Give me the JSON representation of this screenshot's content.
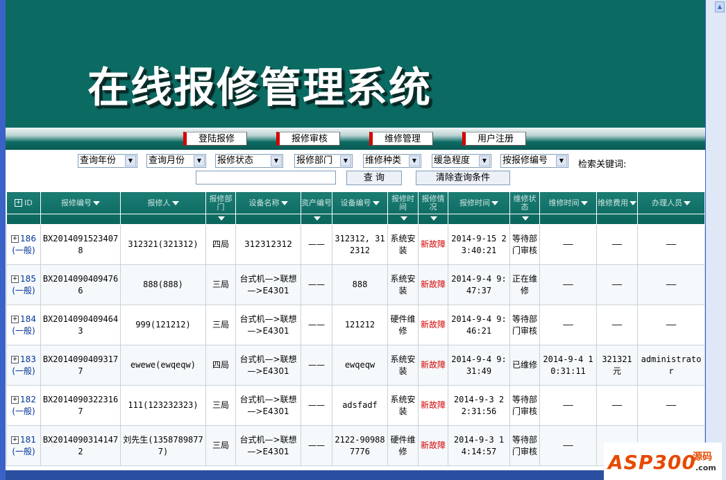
{
  "banner": {
    "title": "在线报修管理系统"
  },
  "nav": [
    "登陆报修",
    "报修审核",
    "维修管理",
    "用户注册"
  ],
  "filters": {
    "selects": [
      "查询年份",
      "查询月份",
      "报修状态",
      "报修部门",
      "维修种类",
      "缓急程度",
      "按报修编号"
    ],
    "keyword_label": "检索关键词:",
    "search_button": "查 询",
    "clear_button": "清除查询条件"
  },
  "table": {
    "headers": [
      "ID",
      "报修编号",
      "报修人",
      "报修部门",
      "设备名称",
      "资产编号",
      "设备编号",
      "报修时间",
      "报修情况",
      "报修时间",
      "维修状态",
      "维修时间",
      "维修费用",
      "办理人员"
    ],
    "rows": [
      {
        "id": "186",
        "level": "(一般)",
        "no": "BX20140915234078",
        "reporter": "312321(321312)",
        "dept": "四局",
        "device": "312312312",
        "asset": "——",
        "device_no": "312312, 312312",
        "fault_time": "系统安装",
        "status": "新故障",
        "report_time": "2014-9-15 23:40:21",
        "repair_state": "等待部门审核",
        "repair_time": "——",
        "fee": "——",
        "handler": "——"
      },
      {
        "id": "185",
        "level": "(一般)",
        "no": "BX20140904094766",
        "reporter": "888(888)",
        "dept": "三局",
        "device": "台式机—>联想—>E4301",
        "asset": "——",
        "device_no": "888",
        "fault_time": "系统安装",
        "status": "新故障",
        "report_time": "2014-9-4 9:47:37",
        "repair_state": "正在维修",
        "repair_time": "——",
        "fee": "——",
        "handler": "——"
      },
      {
        "id": "184",
        "level": "(一般)",
        "no": "BX20140904094643",
        "reporter": "999(121212)",
        "dept": "三局",
        "device": "台式机—>联想—>E4301",
        "asset": "——",
        "device_no": "121212",
        "fault_time": "硬件维修",
        "status": "新故障",
        "report_time": "2014-9-4 9:46:21",
        "repair_state": "等待部门审核",
        "repair_time": "——",
        "fee": "——",
        "handler": "——"
      },
      {
        "id": "183",
        "level": "(一般)",
        "no": "BX20140904093177",
        "reporter": "ewewe(ewqeqw)",
        "dept": "四局",
        "device": "台式机—>联想—>E4301",
        "asset": "——",
        "device_no": "ewqeqw",
        "fault_time": "系统安装",
        "status": "新故障",
        "report_time": "2014-9-4 9:31:49",
        "repair_state": "已维修",
        "repair_time": "2014-9-4 10:31:11",
        "fee": "321321元",
        "handler": "administrator"
      },
      {
        "id": "182",
        "level": "(一般)",
        "no": "BX20140903223167",
        "reporter": "111(123232323)",
        "dept": "三局",
        "device": "台式机—>联想—>E4301",
        "asset": "——",
        "device_no": "adsfadf",
        "fault_time": "系统安装",
        "status": "新故障",
        "report_time": "2014-9-3 22:31:56",
        "repair_state": "等待部门审核",
        "repair_time": "——",
        "fee": "——",
        "handler": "——"
      },
      {
        "id": "181",
        "level": "(一般)",
        "no": "BX20140903141472",
        "reporter": "刘先生(13587898777)",
        "dept": "三局",
        "device": "台式机—>联想—>E4301",
        "asset": "——",
        "device_no": "2122-909887776",
        "fault_time": "硬件维修",
        "status": "新故障",
        "report_time": "2014-9-3 14:14:57",
        "repair_state": "等待部门审核",
        "repair_time": "——",
        "fee": "",
        "handler": ""
      }
    ]
  },
  "watermark": {
    "brand": "ASP300",
    "sub": "源码",
    "domain": ".com"
  },
  "colors": {
    "banner": "#0b6b63",
    "header": "#0a655c",
    "accent_red": "#d50000",
    "frame_blue": "#3a62c7"
  }
}
